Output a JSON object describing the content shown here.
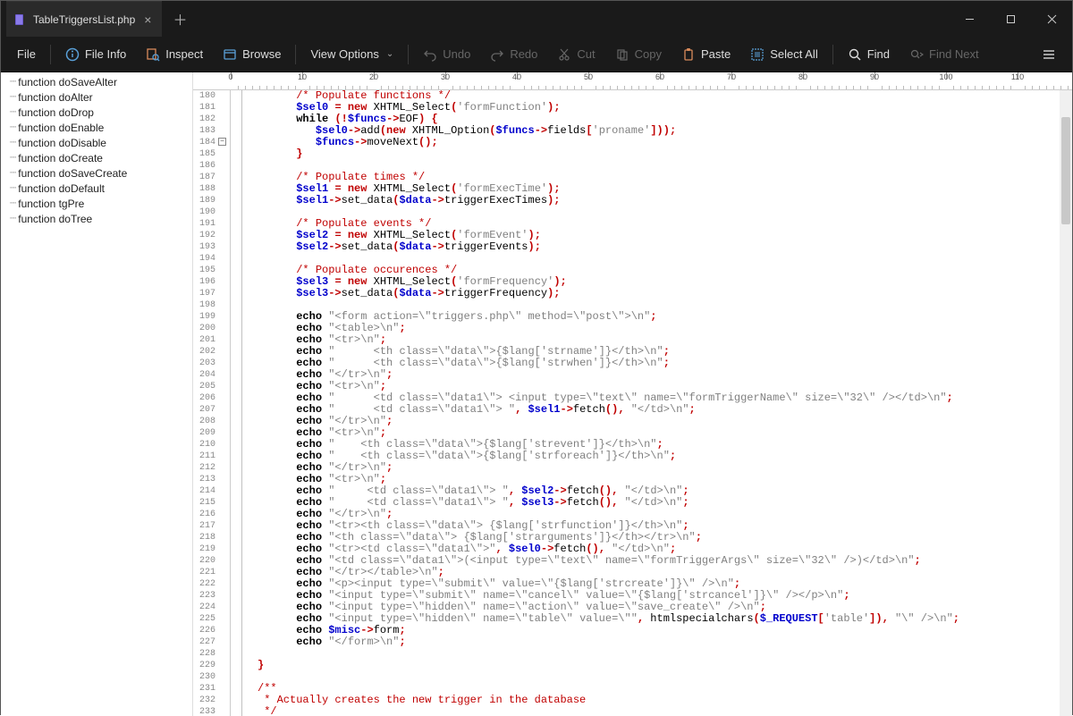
{
  "tab": {
    "title": "TableTriggersList.php"
  },
  "toolbar": {
    "file": "File",
    "file_info": "File Info",
    "inspect": "Inspect",
    "browse": "Browse",
    "view_options": "View Options",
    "undo": "Undo",
    "redo": "Redo",
    "cut": "Cut",
    "copy": "Copy",
    "paste": "Paste",
    "select_all": "Select All",
    "find": "Find",
    "find_next": "Find Next"
  },
  "sidebar": {
    "items": [
      "function doSaveAlter",
      "function doAlter",
      "function doDrop",
      "function doEnable",
      "function doDisable",
      "function doCreate",
      "function doSaveCreate",
      "function doDefault",
      "function tgPre",
      "function doTree"
    ]
  },
  "ruler": {
    "max": 120
  },
  "gutter": {
    "start": 180,
    "end": 233,
    "fold_at": 184
  },
  "code_lines": [
    {
      "i": "      ",
      "t": [
        [
          "com",
          "/* Populate functions */"
        ]
      ]
    },
    {
      "i": "      ",
      "t": [
        [
          "var",
          "$sel0"
        ],
        [
          "txt",
          " "
        ],
        [
          "op",
          "="
        ],
        [
          "txt",
          " "
        ],
        [
          "op",
          "new"
        ],
        [
          "txt",
          " XHTML_Select"
        ],
        [
          "bkt",
          "("
        ],
        [
          "str",
          "'formFunction'"
        ],
        [
          "bkt",
          ")"
        ],
        [
          "op",
          ";"
        ]
      ]
    },
    {
      "i": "      ",
      "t": [
        [
          "kw",
          "while"
        ],
        [
          "txt",
          " "
        ],
        [
          "bkt",
          "("
        ],
        [
          "op",
          "!"
        ],
        [
          "var",
          "$funcs"
        ],
        [
          "arrow",
          "->"
        ],
        [
          "txt",
          "EOF"
        ],
        [
          "bkt",
          ")"
        ],
        [
          "txt",
          " "
        ],
        [
          "bkt",
          "{"
        ]
      ]
    },
    {
      "i": "         ",
      "t": [
        [
          "var",
          "$sel0"
        ],
        [
          "arrow",
          "->"
        ],
        [
          "txt",
          "add"
        ],
        [
          "bkt",
          "("
        ],
        [
          "op",
          "new"
        ],
        [
          "txt",
          " XHTML_Option"
        ],
        [
          "bkt",
          "("
        ],
        [
          "var",
          "$funcs"
        ],
        [
          "arrow",
          "->"
        ],
        [
          "txt",
          "fields"
        ],
        [
          "bkt",
          "["
        ],
        [
          "str",
          "'proname'"
        ],
        [
          "bkt",
          "]"
        ],
        [
          "bkt",
          "))"
        ],
        [
          "op",
          ";"
        ]
      ]
    },
    {
      "i": "         ",
      "t": [
        [
          "var",
          "$funcs"
        ],
        [
          "arrow",
          "->"
        ],
        [
          "txt",
          "moveNext"
        ],
        [
          "bkt",
          "()"
        ],
        [
          "op",
          ";"
        ]
      ]
    },
    {
      "i": "      ",
      "t": [
        [
          "bkt",
          "}"
        ]
      ]
    },
    {
      "i": "",
      "t": []
    },
    {
      "i": "      ",
      "t": [
        [
          "com",
          "/* Populate times */"
        ]
      ]
    },
    {
      "i": "      ",
      "t": [
        [
          "var",
          "$sel1"
        ],
        [
          "txt",
          " "
        ],
        [
          "op",
          "="
        ],
        [
          "txt",
          " "
        ],
        [
          "op",
          "new"
        ],
        [
          "txt",
          " XHTML_Select"
        ],
        [
          "bkt",
          "("
        ],
        [
          "str",
          "'formExecTime'"
        ],
        [
          "bkt",
          ")"
        ],
        [
          "op",
          ";"
        ]
      ]
    },
    {
      "i": "      ",
      "t": [
        [
          "var",
          "$sel1"
        ],
        [
          "arrow",
          "->"
        ],
        [
          "txt",
          "set_data"
        ],
        [
          "bkt",
          "("
        ],
        [
          "var",
          "$data"
        ],
        [
          "arrow",
          "->"
        ],
        [
          "txt",
          "triggerExecTimes"
        ],
        [
          "bkt",
          ")"
        ],
        [
          "op",
          ";"
        ]
      ]
    },
    {
      "i": "",
      "t": []
    },
    {
      "i": "      ",
      "t": [
        [
          "com",
          "/* Populate events */"
        ]
      ]
    },
    {
      "i": "      ",
      "t": [
        [
          "var",
          "$sel2"
        ],
        [
          "txt",
          " "
        ],
        [
          "op",
          "="
        ],
        [
          "txt",
          " "
        ],
        [
          "op",
          "new"
        ],
        [
          "txt",
          " XHTML_Select"
        ],
        [
          "bkt",
          "("
        ],
        [
          "str",
          "'formEvent'"
        ],
        [
          "bkt",
          ")"
        ],
        [
          "op",
          ";"
        ]
      ]
    },
    {
      "i": "      ",
      "t": [
        [
          "var",
          "$sel2"
        ],
        [
          "arrow",
          "->"
        ],
        [
          "txt",
          "set_data"
        ],
        [
          "bkt",
          "("
        ],
        [
          "var",
          "$data"
        ],
        [
          "arrow",
          "->"
        ],
        [
          "txt",
          "triggerEvents"
        ],
        [
          "bkt",
          ")"
        ],
        [
          "op",
          ";"
        ]
      ]
    },
    {
      "i": "",
      "t": []
    },
    {
      "i": "      ",
      "t": [
        [
          "com",
          "/* Populate occurences */"
        ]
      ]
    },
    {
      "i": "      ",
      "t": [
        [
          "var",
          "$sel3"
        ],
        [
          "txt",
          " "
        ],
        [
          "op",
          "="
        ],
        [
          "txt",
          " "
        ],
        [
          "op",
          "new"
        ],
        [
          "txt",
          " XHTML_Select"
        ],
        [
          "bkt",
          "("
        ],
        [
          "str",
          "'formFrequency'"
        ],
        [
          "bkt",
          ")"
        ],
        [
          "op",
          ";"
        ]
      ]
    },
    {
      "i": "      ",
      "t": [
        [
          "var",
          "$sel3"
        ],
        [
          "arrow",
          "->"
        ],
        [
          "txt",
          "set_data"
        ],
        [
          "bkt",
          "("
        ],
        [
          "var",
          "$data"
        ],
        [
          "arrow",
          "->"
        ],
        [
          "txt",
          "triggerFrequency"
        ],
        [
          "bkt",
          ")"
        ],
        [
          "op",
          ";"
        ]
      ]
    },
    {
      "i": "",
      "t": []
    },
    {
      "i": "      ",
      "t": [
        [
          "kw",
          "echo"
        ],
        [
          "txt",
          " "
        ],
        [
          "str",
          "\"<form action=\\\"triggers.php\\\" method=\\\"post\\\">\\n\""
        ],
        [
          "op",
          ";"
        ]
      ]
    },
    {
      "i": "      ",
      "t": [
        [
          "kw",
          "echo"
        ],
        [
          "txt",
          " "
        ],
        [
          "str",
          "\"<table>\\n\""
        ],
        [
          "op",
          ";"
        ]
      ]
    },
    {
      "i": "      ",
      "t": [
        [
          "kw",
          "echo"
        ],
        [
          "txt",
          " "
        ],
        [
          "str",
          "\"<tr>\\n\""
        ],
        [
          "op",
          ";"
        ]
      ]
    },
    {
      "i": "      ",
      "t": [
        [
          "kw",
          "echo"
        ],
        [
          "txt",
          " "
        ],
        [
          "str",
          "\"      <th class=\\\"data\\\">{$lang['strname']}</th>\\n\""
        ],
        [
          "op",
          ";"
        ]
      ]
    },
    {
      "i": "      ",
      "t": [
        [
          "kw",
          "echo"
        ],
        [
          "txt",
          " "
        ],
        [
          "str",
          "\"      <th class=\\\"data\\\">{$lang['strwhen']}</th>\\n\""
        ],
        [
          "op",
          ";"
        ]
      ]
    },
    {
      "i": "      ",
      "t": [
        [
          "kw",
          "echo"
        ],
        [
          "txt",
          " "
        ],
        [
          "str",
          "\"</tr>\\n\""
        ],
        [
          "op",
          ";"
        ]
      ]
    },
    {
      "i": "      ",
      "t": [
        [
          "kw",
          "echo"
        ],
        [
          "txt",
          " "
        ],
        [
          "str",
          "\"<tr>\\n\""
        ],
        [
          "op",
          ";"
        ]
      ]
    },
    {
      "i": "      ",
      "t": [
        [
          "kw",
          "echo"
        ],
        [
          "txt",
          " "
        ],
        [
          "str",
          "\"      <td class=\\\"data1\\\"> <input type=\\\"text\\\" name=\\\"formTriggerName\\\" size=\\\"32\\\" /></td>\\n\""
        ],
        [
          "op",
          ";"
        ]
      ]
    },
    {
      "i": "      ",
      "t": [
        [
          "kw",
          "echo"
        ],
        [
          "txt",
          " "
        ],
        [
          "str",
          "\"      <td class=\\\"data1\\\"> \""
        ],
        [
          "op",
          ","
        ],
        [
          "txt",
          " "
        ],
        [
          "var",
          "$sel1"
        ],
        [
          "arrow",
          "->"
        ],
        [
          "txt",
          "fetch"
        ],
        [
          "bkt",
          "()"
        ],
        [
          "op",
          ","
        ],
        [
          "txt",
          " "
        ],
        [
          "str",
          "\"</td>\\n\""
        ],
        [
          "op",
          ";"
        ]
      ]
    },
    {
      "i": "      ",
      "t": [
        [
          "kw",
          "echo"
        ],
        [
          "txt",
          " "
        ],
        [
          "str",
          "\"</tr>\\n\""
        ],
        [
          "op",
          ";"
        ]
      ]
    },
    {
      "i": "      ",
      "t": [
        [
          "kw",
          "echo"
        ],
        [
          "txt",
          " "
        ],
        [
          "str",
          "\"<tr>\\n\""
        ],
        [
          "op",
          ";"
        ]
      ]
    },
    {
      "i": "      ",
      "t": [
        [
          "kw",
          "echo"
        ],
        [
          "txt",
          " "
        ],
        [
          "str",
          "\"    <th class=\\\"data\\\">{$lang['strevent']}</th>\\n\""
        ],
        [
          "op",
          ";"
        ]
      ]
    },
    {
      "i": "      ",
      "t": [
        [
          "kw",
          "echo"
        ],
        [
          "txt",
          " "
        ],
        [
          "str",
          "\"    <th class=\\\"data\\\">{$lang['strforeach']}</th>\\n\""
        ],
        [
          "op",
          ";"
        ]
      ]
    },
    {
      "i": "      ",
      "t": [
        [
          "kw",
          "echo"
        ],
        [
          "txt",
          " "
        ],
        [
          "str",
          "\"</tr>\\n\""
        ],
        [
          "op",
          ";"
        ]
      ]
    },
    {
      "i": "      ",
      "t": [
        [
          "kw",
          "echo"
        ],
        [
          "txt",
          " "
        ],
        [
          "str",
          "\"<tr>\\n\""
        ],
        [
          "op",
          ";"
        ]
      ]
    },
    {
      "i": "      ",
      "t": [
        [
          "kw",
          "echo"
        ],
        [
          "txt",
          " "
        ],
        [
          "str",
          "\"     <td class=\\\"data1\\\"> \""
        ],
        [
          "op",
          ","
        ],
        [
          "txt",
          " "
        ],
        [
          "var",
          "$sel2"
        ],
        [
          "arrow",
          "->"
        ],
        [
          "txt",
          "fetch"
        ],
        [
          "bkt",
          "()"
        ],
        [
          "op",
          ","
        ],
        [
          "txt",
          " "
        ],
        [
          "str",
          "\"</td>\\n\""
        ],
        [
          "op",
          ";"
        ]
      ]
    },
    {
      "i": "      ",
      "t": [
        [
          "kw",
          "echo"
        ],
        [
          "txt",
          " "
        ],
        [
          "str",
          "\"     <td class=\\\"data1\\\"> \""
        ],
        [
          "op",
          ","
        ],
        [
          "txt",
          " "
        ],
        [
          "var",
          "$sel3"
        ],
        [
          "arrow",
          "->"
        ],
        [
          "txt",
          "fetch"
        ],
        [
          "bkt",
          "()"
        ],
        [
          "op",
          ","
        ],
        [
          "txt",
          " "
        ],
        [
          "str",
          "\"</td>\\n\""
        ],
        [
          "op",
          ";"
        ]
      ]
    },
    {
      "i": "      ",
      "t": [
        [
          "kw",
          "echo"
        ],
        [
          "txt",
          " "
        ],
        [
          "str",
          "\"</tr>\\n\""
        ],
        [
          "op",
          ";"
        ]
      ]
    },
    {
      "i": "      ",
      "t": [
        [
          "kw",
          "echo"
        ],
        [
          "txt",
          " "
        ],
        [
          "str",
          "\"<tr><th class=\\\"data\\\"> {$lang['strfunction']}</th>\\n\""
        ],
        [
          "op",
          ";"
        ]
      ]
    },
    {
      "i": "      ",
      "t": [
        [
          "kw",
          "echo"
        ],
        [
          "txt",
          " "
        ],
        [
          "str",
          "\"<th class=\\\"data\\\"> {$lang['strarguments']}</th></tr>\\n\""
        ],
        [
          "op",
          ";"
        ]
      ]
    },
    {
      "i": "      ",
      "t": [
        [
          "kw",
          "echo"
        ],
        [
          "txt",
          " "
        ],
        [
          "str",
          "\"<tr><td class=\\\"data1\\\">\""
        ],
        [
          "op",
          ","
        ],
        [
          "txt",
          " "
        ],
        [
          "var",
          "$sel0"
        ],
        [
          "arrow",
          "->"
        ],
        [
          "txt",
          "fetch"
        ],
        [
          "bkt",
          "()"
        ],
        [
          "op",
          ","
        ],
        [
          "txt",
          " "
        ],
        [
          "str",
          "\"</td>\\n\""
        ],
        [
          "op",
          ";"
        ]
      ]
    },
    {
      "i": "      ",
      "t": [
        [
          "kw",
          "echo"
        ],
        [
          "txt",
          " "
        ],
        [
          "str",
          "\"<td class=\\\"data1\\\">(<input type=\\\"text\\\" name=\\\"formTriggerArgs\\\" size=\\\"32\\\" />)</td>\\n\""
        ],
        [
          "op",
          ";"
        ]
      ]
    },
    {
      "i": "      ",
      "t": [
        [
          "kw",
          "echo"
        ],
        [
          "txt",
          " "
        ],
        [
          "str",
          "\"</tr></table>\\n\""
        ],
        [
          "op",
          ";"
        ]
      ]
    },
    {
      "i": "      ",
      "t": [
        [
          "kw",
          "echo"
        ],
        [
          "txt",
          " "
        ],
        [
          "str",
          "\"<p><input type=\\\"submit\\\" value=\\\"{$lang['strcreate']}\\\" />\\n\""
        ],
        [
          "op",
          ";"
        ]
      ]
    },
    {
      "i": "      ",
      "t": [
        [
          "kw",
          "echo"
        ],
        [
          "txt",
          " "
        ],
        [
          "str",
          "\"<input type=\\\"submit\\\" name=\\\"cancel\\\" value=\\\"{$lang['strcancel']}\\\" /></p>\\n\""
        ],
        [
          "op",
          ";"
        ]
      ]
    },
    {
      "i": "      ",
      "t": [
        [
          "kw",
          "echo"
        ],
        [
          "txt",
          " "
        ],
        [
          "str",
          "\"<input type=\\\"hidden\\\" name=\\\"action\\\" value=\\\"save_create\\\" />\\n\""
        ],
        [
          "op",
          ";"
        ]
      ]
    },
    {
      "i": "      ",
      "t": [
        [
          "kw",
          "echo"
        ],
        [
          "txt",
          " "
        ],
        [
          "str",
          "\"<input type=\\\"hidden\\\" name=\\\"table\\\" value=\\\"\""
        ],
        [
          "op",
          ","
        ],
        [
          "txt",
          " htmlspecialchars"
        ],
        [
          "bkt",
          "("
        ],
        [
          "var",
          "$_REQUEST"
        ],
        [
          "bkt",
          "["
        ],
        [
          "str",
          "'table'"
        ],
        [
          "bkt",
          "]"
        ],
        [
          "bkt",
          ")"
        ],
        [
          "op",
          ","
        ],
        [
          "txt",
          " "
        ],
        [
          "str",
          "\"\\\" />\\n\""
        ],
        [
          "op",
          ";"
        ]
      ]
    },
    {
      "i": "      ",
      "t": [
        [
          "kw",
          "echo"
        ],
        [
          "txt",
          " "
        ],
        [
          "var",
          "$misc"
        ],
        [
          "arrow",
          "->"
        ],
        [
          "txt",
          "form"
        ],
        [
          "op",
          ";"
        ]
      ]
    },
    {
      "i": "      ",
      "t": [
        [
          "kw",
          "echo"
        ],
        [
          "txt",
          " "
        ],
        [
          "str",
          "\"</form>\\n\""
        ],
        [
          "op",
          ";"
        ]
      ]
    },
    {
      "i": "",
      "t": []
    },
    {
      "i": "",
      "t": [
        [
          "bkt",
          "}"
        ]
      ]
    },
    {
      "i": "",
      "t": []
    },
    {
      "i": "",
      "t": [
        [
          "com",
          "/**"
        ]
      ]
    },
    {
      "i": "",
      "t": [
        [
          "com",
          " * Actually creates the new trigger in the database"
        ]
      ]
    },
    {
      "i": "",
      "t": [
        [
          "com",
          " */"
        ]
      ]
    }
  ]
}
